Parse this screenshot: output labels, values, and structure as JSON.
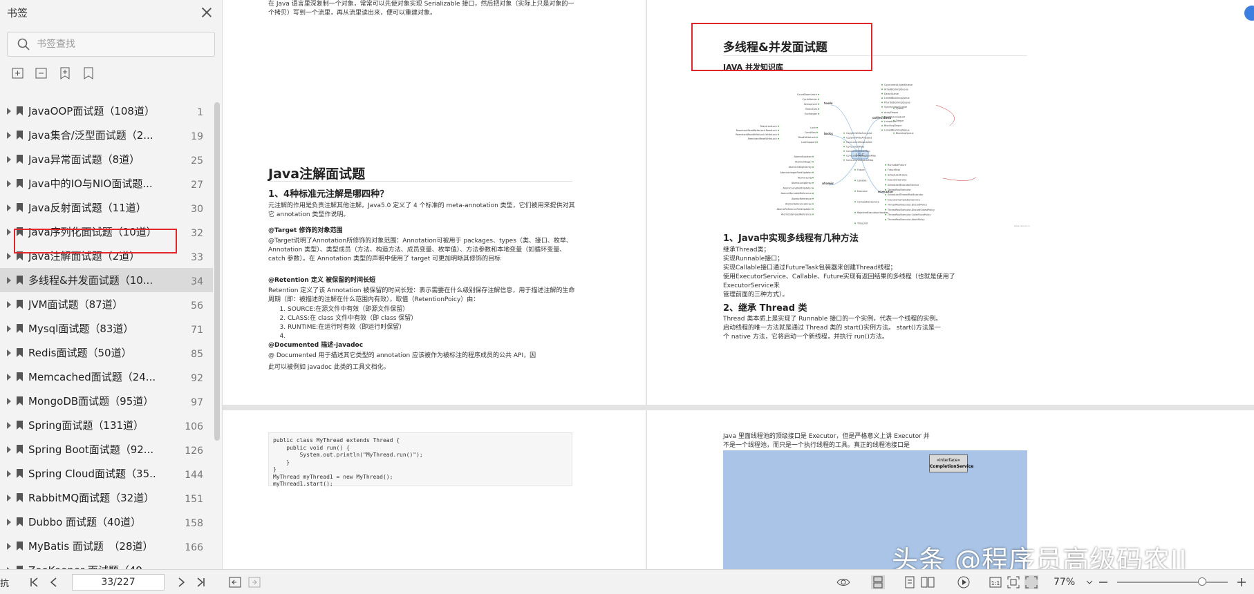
{
  "sidebar": {
    "title": "书签",
    "search_placeholder": "书签查找",
    "items": [
      {
        "label": "JavaOOP面试题（108道）",
        "page": "1"
      },
      {
        "label": "Java集合/泛型面试题（2...",
        "page": "19"
      },
      {
        "label": "Java异常面试题（8道）",
        "page": "25"
      },
      {
        "label": "Java中的IO与NIO面试题...",
        "page": "27"
      },
      {
        "label": "Java反射面试题（11道）",
        "page": "30"
      },
      {
        "label": "Java序列化面试题（10道）",
        "page": "32"
      },
      {
        "label": "Java注解面试题（2道）",
        "page": "33"
      },
      {
        "label": "多线程&并发面试题（10...",
        "page": "34"
      },
      {
        "label": "JVM面试题（87道）",
        "page": "56"
      },
      {
        "label": "Mysql面试题（83道）",
        "page": "71"
      },
      {
        "label": "Redis面试题（50道）",
        "page": "85"
      },
      {
        "label": "Memcached面试题（24...",
        "page": "92"
      },
      {
        "label": "MongoDB面试题（95道）",
        "page": "97"
      },
      {
        "label": "Spring面试题（131道）",
        "page": "106"
      },
      {
        "label": "Spring Boot面试题（92...",
        "page": "126"
      },
      {
        "label": "Spring Cloud面试题（35...",
        "page": "144"
      },
      {
        "label": "RabbitMQ面试题（32道）",
        "page": "151"
      },
      {
        "label": "Dubbo 面试题（40道）",
        "page": "158"
      },
      {
        "label": "MyBatis 面试题　（28道）",
        "page": "166"
      },
      {
        "label": "ZooKeeper 面试题（49",
        "page": ""
      }
    ]
  },
  "left_page": {
    "top_text": "在 Java 语言里深复制一个对象，常常可以先使对象实现 Serializable 接口，然后把对象（实际上只是对象的一个拷贝）写到一个流里，再从流里读出来，便可以重建对象。",
    "title": "Java注解面试题",
    "q1": "1、4种标准元注解是哪四种？",
    "q1_text": "元注解的作用是负责注解其他注解。Java5.0 定义了 4 个标准的 meta-annotation 类型，它们被用来提供对其它 annotation 类型作说明。",
    "target_h": "@Target 修饰的对象范围",
    "target_text": "@Target说明了Annotation所修饰的对象范围：Annotation可被用于 packages、types（类、接口、枚举、Annotation 类型）、类型成员（方法、构造方法、成员变量、枚举值）、方法参数和本地变量（如循环变量、catch 参数）。在 Annotation 类型的声明中使用了 target 可更加明晰其修饰的目标",
    "retention_h": "@Retention 定义 被保留的时间长短",
    "retention_text": "Retention 定义了该 Annotation 被保留的时间长短：表示需要在什么级别保存注解信息，用于描述注解的生命周期（即：被描述的注解在什么范围内有效），取值（RetentionPoicy）由：",
    "retention_list": [
      "SOURCE:在源文件中有效（即源文件保留）",
      "CLASS:在 class 文件中有效（即 class 保留）",
      "RUNTIME:在运行时有效（即运行时保留）",
      ""
    ],
    "documented_h": "@Documented 描述-javadoc",
    "documented_text": "@ Documented 用于描述其它类型的 annotation 应该被作为被标注的程序成员的公共 API，因",
    "documented_text2": "此可以被例如 javadoc 此类的工具文档化。"
  },
  "right_page": {
    "title": "多线程&并发面试题",
    "subtitle": "JAVA 并发知识库",
    "q1": "1、Java中实现多线程有几种方法",
    "q1_lines": [
      "继承Thread类；",
      "实现Runnable接口；",
      "实现Callable接口通过FutureTask包装器来创建Thread线程；",
      "使用ExecutorService、Callable、Future实现有返回结果的多线程（也就是使用了ExecutorService来",
      "管理前面的三种方式）。"
    ],
    "q2": "2、继承 Thread 类",
    "q2_text": "Thread 类本质上是实现了 Runnable 接口的一个实例，代表一个线程的实例。 启动线程的唯一方法就是通过 Thread 类的 start()实例方法。 start()方法是一个 native 方法，它将启动一个新线程，并执行 run()方法。",
    "mindmap": {
      "center": "J.U.C",
      "branches": [
        "tools",
        "locks",
        "atomic",
        "collections",
        "executor"
      ],
      "tools": [
        "CountDownLatch",
        "CyclicBarrier",
        "Semaphore",
        "Executors",
        "Exchanger"
      ],
      "locks": [
        "Lock",
        "Condition",
        "ReadWriteLock",
        "LockSupport",
        "ReentrantLock",
        "ReentrantReadWriteLock.ReadLock",
        "ReentrantReadWriteLock.WriteLock",
        "ReentrantReadWriteLock"
      ],
      "atomic": [
        "AtomicBoolean",
        "AtomicInteger",
        "AtomicIntegerArray",
        "AtomicIntegerFieldUpdater",
        "AtomicLong",
        "AtomicLongArray",
        "AtomicLongFieldUpdater",
        "AtomicMarkableReference",
        "AtomicReference",
        "AtomicReferenceArray",
        "AtomicReferenceFieldUpdater",
        "AtomicStampedReference"
      ],
      "collections": [
        "Queue",
        "Deque",
        "BlockingQueue",
        "ConcurrentLinkedQueue",
        "ArrayBlockingQueue",
        "DelayQueue",
        "LinkedBlockingQueue",
        "PriorityBlockingQueue",
        "SynchronousQueue",
        "ArrayDeque",
        "IdentityLinkedList",
        "LinkedList",
        "BlockingDeque",
        "LinkedBlockingDeque",
        "CopyOnWriteArrayList",
        "CopyOnWriteArraySet",
        "ConcurrentSkipListSet",
        "ConcurrentMap",
        "ConcurrentHashMap",
        "ConcurrentNavigableMap",
        "ConcurrentSkipListMap"
      ],
      "executor": [
        "Future",
        "Callable",
        "Executor",
        "CompletionService",
        "RejectedExecutionHandler",
        "TimeUnit",
        "RunnableFuture",
        "FutureTask",
        "ScheduledFuture",
        "ExecutorService",
        "ScheduledExecutorService",
        "ThreadPoolExecutor",
        "ScheduledThreadPoolExecutor",
        "ExecutorCompletionService",
        "ThreadPoolExecutor.DiscardPolicy",
        "ThreadPoolExecutor.DiscardOldestPolicy",
        "ThreadPoolExecutor.CallerRunsPolicy",
        "ThreadPoolExecutor.AbortPolicy"
      ],
      "watermark": "www.xxxxxx.cn"
    }
  },
  "bottom_left_page": {
    "code": "public class MyThread extends Thread {\n    public void run() {\n        System.out.println(\"MyThread.run()\");\n    }\n}\nMyThread myThread1 = new MyThread();\nmyThread1.start();"
  },
  "bottom_right_page": {
    "text": "Java 里面线程池的顶级接口是 Executor，但是严格意义上讲 Executor 并不是一个线程池，而只是一个执行线程的工具。真正的线程池接口是 ExecutorService。",
    "diagram_interface": "«interface»",
    "diagram_label": "CompletionService"
  },
  "bottombar": {
    "left_edge": "抗",
    "page": "33/227",
    "zoom": "77%",
    "zoom_level": 0.77
  },
  "watermark": "头条 @程序员高级码农II",
  "colors": {
    "highlight_red": "#e0262a",
    "selected_bg": "#dadada",
    "mindmap_green": "#5aa85a",
    "mindmap_blue": "#7aa7d8"
  }
}
